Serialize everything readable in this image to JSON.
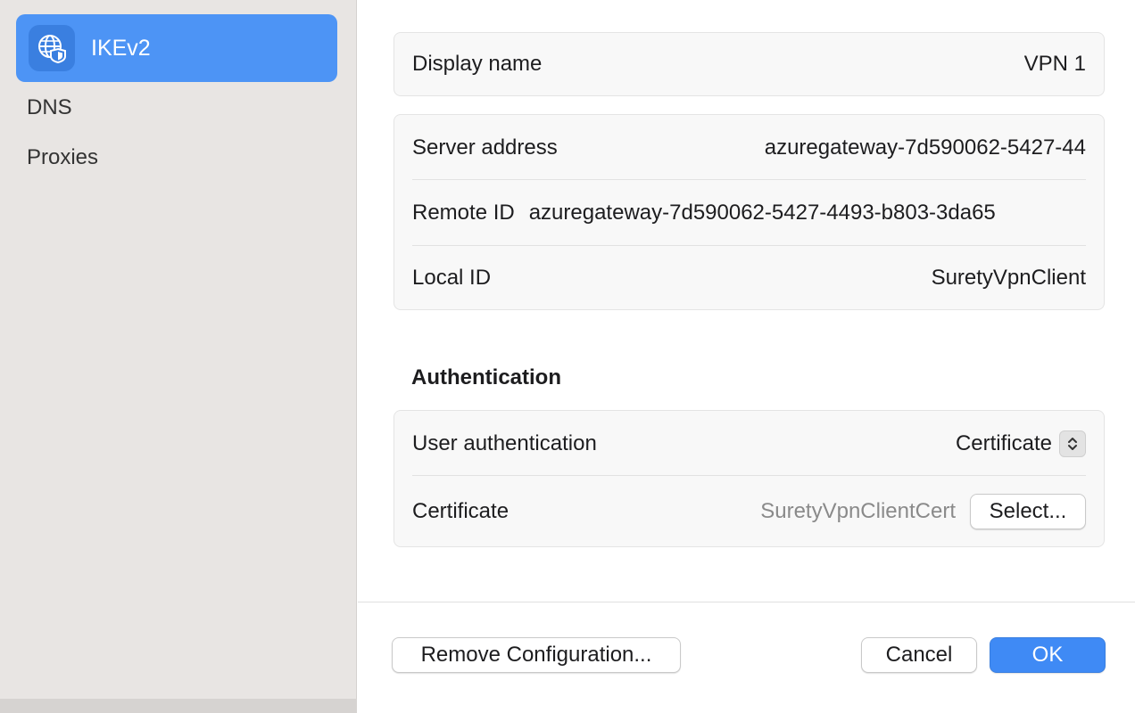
{
  "sidebar": {
    "items": [
      {
        "label": "IKEv2",
        "icon": "globe-shield-icon",
        "selected": true
      },
      {
        "label": "DNS"
      },
      {
        "label": "Proxies"
      }
    ]
  },
  "general": {
    "display_name_label": "Display name",
    "display_name_value": "VPN 1"
  },
  "server": {
    "server_address_label": "Server address",
    "server_address_value": "azuregateway-7d590062-5427-44",
    "remote_id_label": "Remote ID",
    "remote_id_value": "azuregateway-7d590062-5427-4493-b803-3da65",
    "local_id_label": "Local ID",
    "local_id_value": "SuretyVpnClient"
  },
  "authentication": {
    "section_title": "Authentication",
    "user_auth_label": "User authentication",
    "user_auth_value": "Certificate",
    "certificate_label": "Certificate",
    "certificate_value": "SuretyVpnClientCert",
    "select_button": "Select..."
  },
  "footer": {
    "remove_button": "Remove Configuration...",
    "cancel_button": "Cancel",
    "ok_button": "OK"
  },
  "colors": {
    "accent": "#3f8af5",
    "sidebar_bg": "#e8e5e3",
    "selected_bg": "#4d94f5"
  }
}
